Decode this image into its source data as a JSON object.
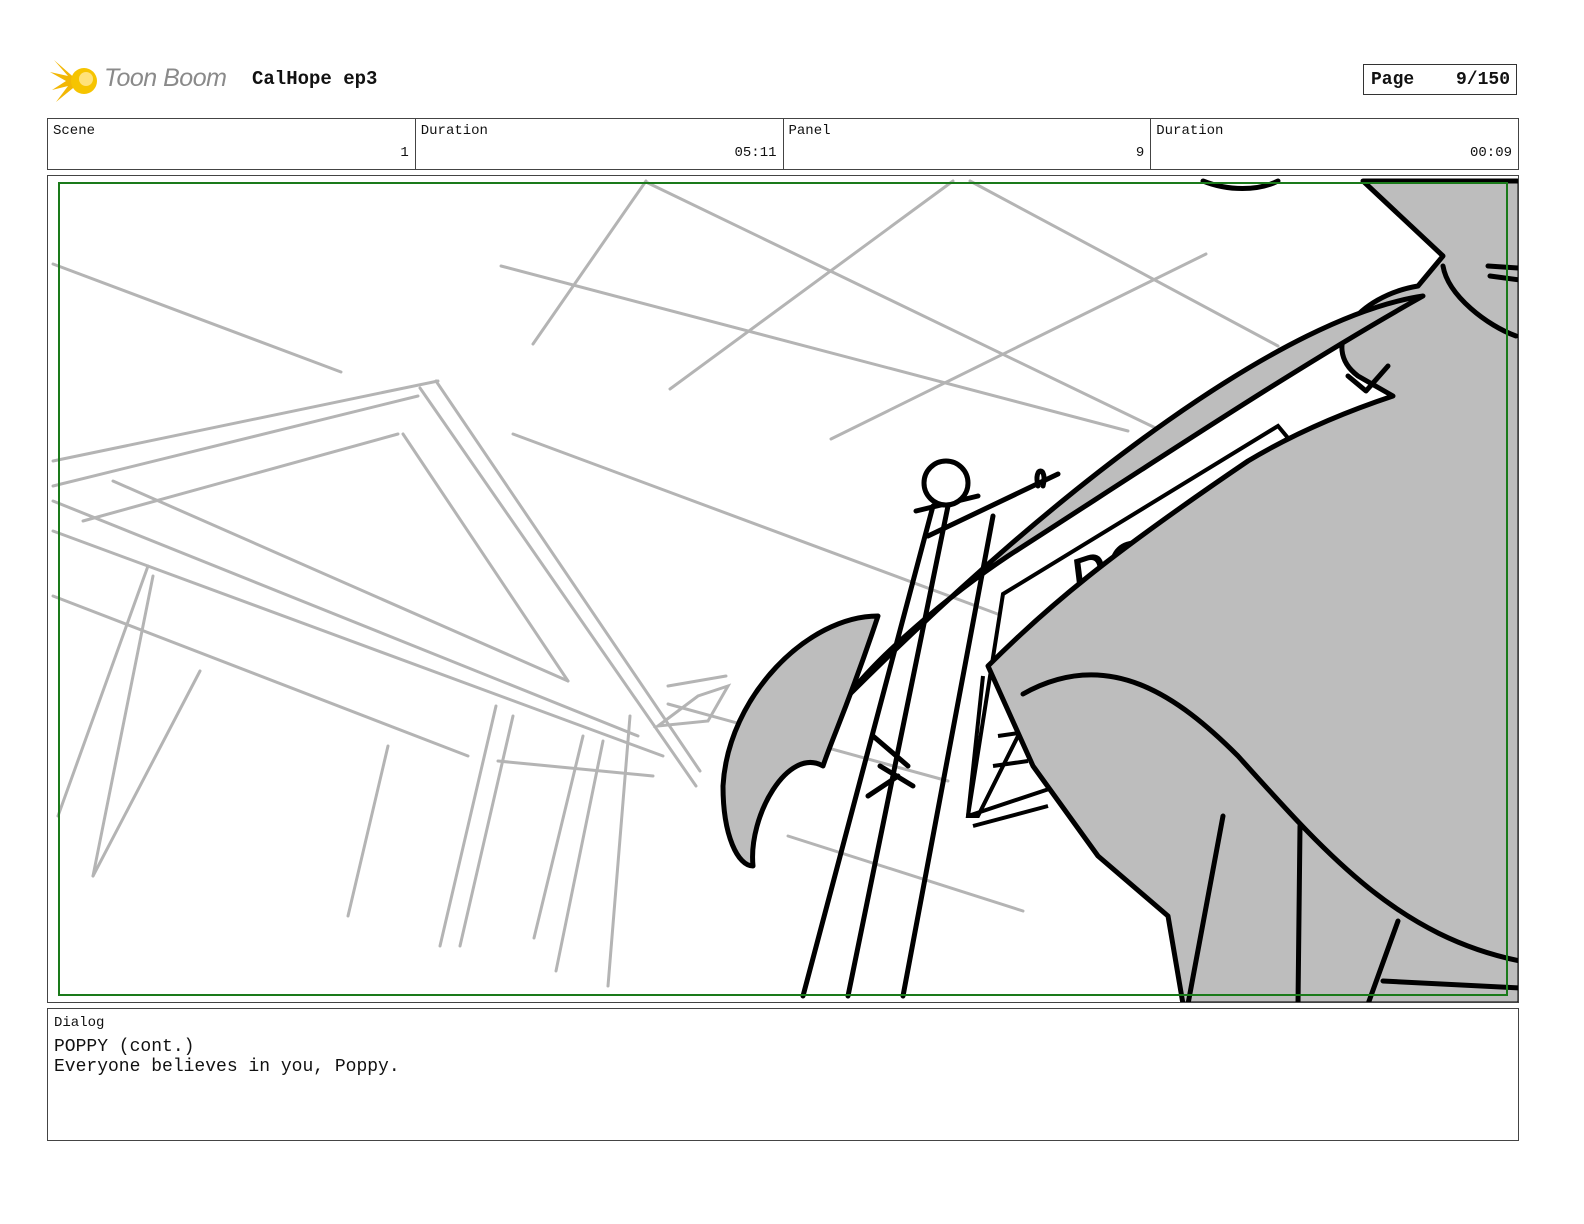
{
  "header": {
    "logo_text": "Toon Boom",
    "project_title": "CalHope ep3",
    "page_label": "Page",
    "page_value": "9/150"
  },
  "info": {
    "scene_label": "Scene",
    "scene_value": "1",
    "scene_duration_label": "Duration",
    "scene_duration_value": "05:11",
    "panel_label": "Panel",
    "panel_value": "9",
    "panel_duration_label": "Duration",
    "panel_duration_value": "00:09"
  },
  "panel_art": {
    "sign_text": "POPPY",
    "colors": {
      "safe_frame": "#1a7a1a",
      "rough_lines": "#b4b4b4",
      "ink": "#000000",
      "fill": "#bdbdbd"
    }
  },
  "dialog": {
    "label": "Dialog",
    "speaker": "POPPY (cont.)",
    "text": "Everyone believes in you, Poppy."
  }
}
